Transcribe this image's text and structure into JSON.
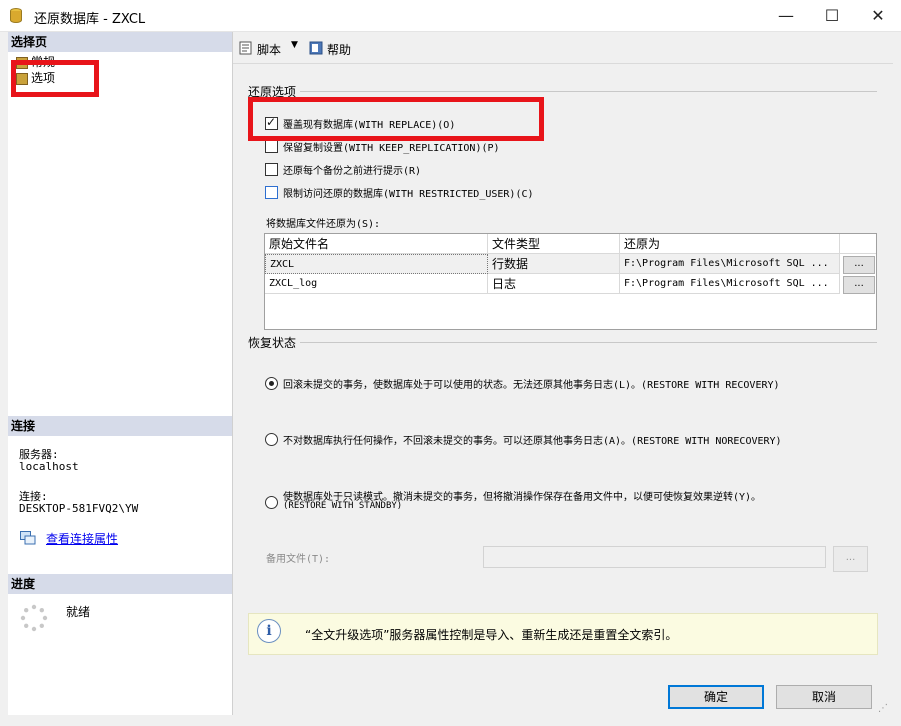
{
  "window": {
    "title": "还原数据库 - ZXCL"
  },
  "left": {
    "select_page_header": "选择页",
    "nav": [
      {
        "label": "常规"
      },
      {
        "label": "选项"
      }
    ],
    "connection_header": "连接",
    "server_label": "服务器:",
    "server_value": "localhost",
    "connection_label": "连接:",
    "connection_value": "DESKTOP-581FVQ2\\YW",
    "view_connection_props": "查看连接属性",
    "progress_header": "进度",
    "progress_status": "就绪"
  },
  "toolbar": {
    "script_label": "脚本",
    "help_label": "帮助"
  },
  "restore_options": {
    "group_title": "还原选项",
    "options": [
      {
        "label": "覆盖现有数据库(WITH REPLACE)(O)",
        "checked": true
      },
      {
        "label": "保留复制设置(WITH KEEP_REPLICATION)(P)",
        "checked": false
      },
      {
        "label": "还原每个备份之前进行提示(R)",
        "checked": false
      },
      {
        "label": "限制访问还原的数据库(WITH RESTRICTED_USER)(C)",
        "checked": false
      }
    ]
  },
  "files": {
    "label": "将数据库文件还原为(S):",
    "columns": [
      "原始文件名",
      "文件类型",
      "还原为"
    ],
    "rows": [
      {
        "original": "ZXCL",
        "type": "行数据",
        "restore_to": "F:\\Program Files\\Microsoft SQL ..."
      },
      {
        "original": "ZXCL_log",
        "type": "日志",
        "restore_to": "F:\\Program Files\\Microsoft SQL ..."
      }
    ],
    "browse_label": "..."
  },
  "recovery": {
    "group_title": "恢复状态",
    "options": [
      {
        "label": "回滚未提交的事务，使数据库处于可以使用的状态。无法还原其他事务日志(L)。(RESTORE WITH RECOVERY)",
        "checked": true
      },
      {
        "label": "不对数据库执行任何操作，不回滚未提交的事务。可以还原其他事务日志(A)。(RESTORE WITH NORECOVERY)",
        "checked": false
      },
      {
        "label": "使数据库处于只读模式。撤消未提交的事务，但将撤消操作保存在备用文件中，以便可使恢复效果逆转(Y)。",
        "label2": "(RESTORE WITH STANDBY)",
        "checked": false
      }
    ],
    "standby_label": "备用文件(T):",
    "standby_value": "",
    "standby_browse": "..."
  },
  "info": {
    "text": "“全文升级选项”服务器属性控制是导入、重新生成还是重置全文索引。"
  },
  "buttons": {
    "ok": "确定",
    "cancel": "取消"
  },
  "colors": {
    "highlight_red": "#e8141a",
    "header_bg": "#d6dbe9",
    "link_blue": "#0000ee"
  }
}
